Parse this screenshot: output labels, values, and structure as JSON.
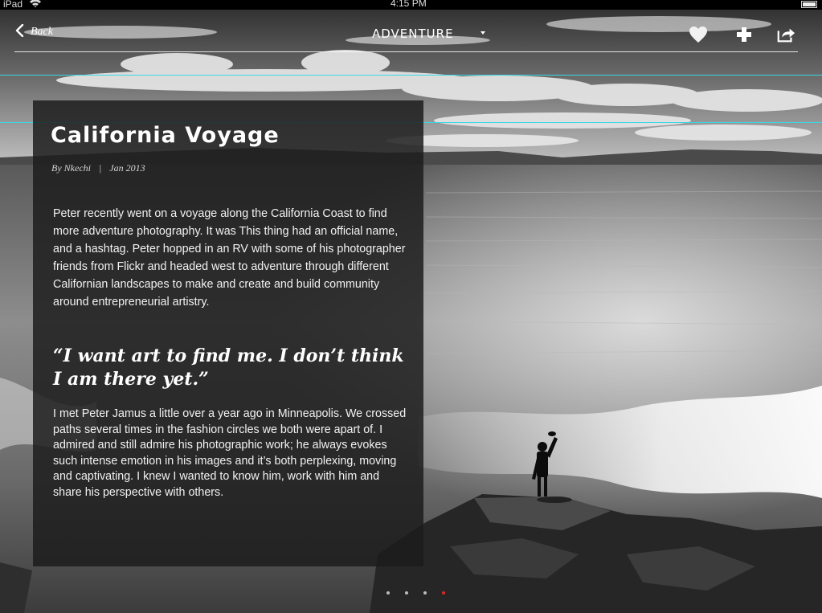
{
  "status_bar": {
    "carrier": "iPad",
    "time": "4:15 PM"
  },
  "nav": {
    "back_label": "Back",
    "section_title": "ADVENTURE"
  },
  "article": {
    "title": "California Voyage",
    "author": "By Nkechi",
    "date": "Jan 2013",
    "paragraph_1": "Peter recently went on a voyage along the California Coast to find more adventure photography. It was This thing had an official name, and a hashtag. Peter hopped in an RV with some of his photographer friends from Flickr and headed west to adventure through different Californian landscapes to make and create and build community around entrepreneurial artistry.",
    "pull_quote": "“I want art to find me. I don’t think I am there yet.”",
    "paragraph_2": "I met Peter Jamus a little over a year ago in Minneapolis. We crossed paths several times in the fashion circles we both were apart of. I admired and still admire his photographic work; he always evokes such intense emotion in his images and it’s both perplexing, moving and captivating. I knew I wanted to know him, work with him and share his perspective with others."
  },
  "pagination": {
    "total": 4,
    "active_index": 4
  },
  "colors": {
    "accent_active_dot": "#e0262a",
    "guide_line": "#3ad7e6"
  },
  "icons": [
    "chevron-left-icon",
    "chevron-down-icon",
    "heart-icon",
    "plus-icon",
    "share-icon",
    "wifi-icon",
    "battery-icon"
  ]
}
